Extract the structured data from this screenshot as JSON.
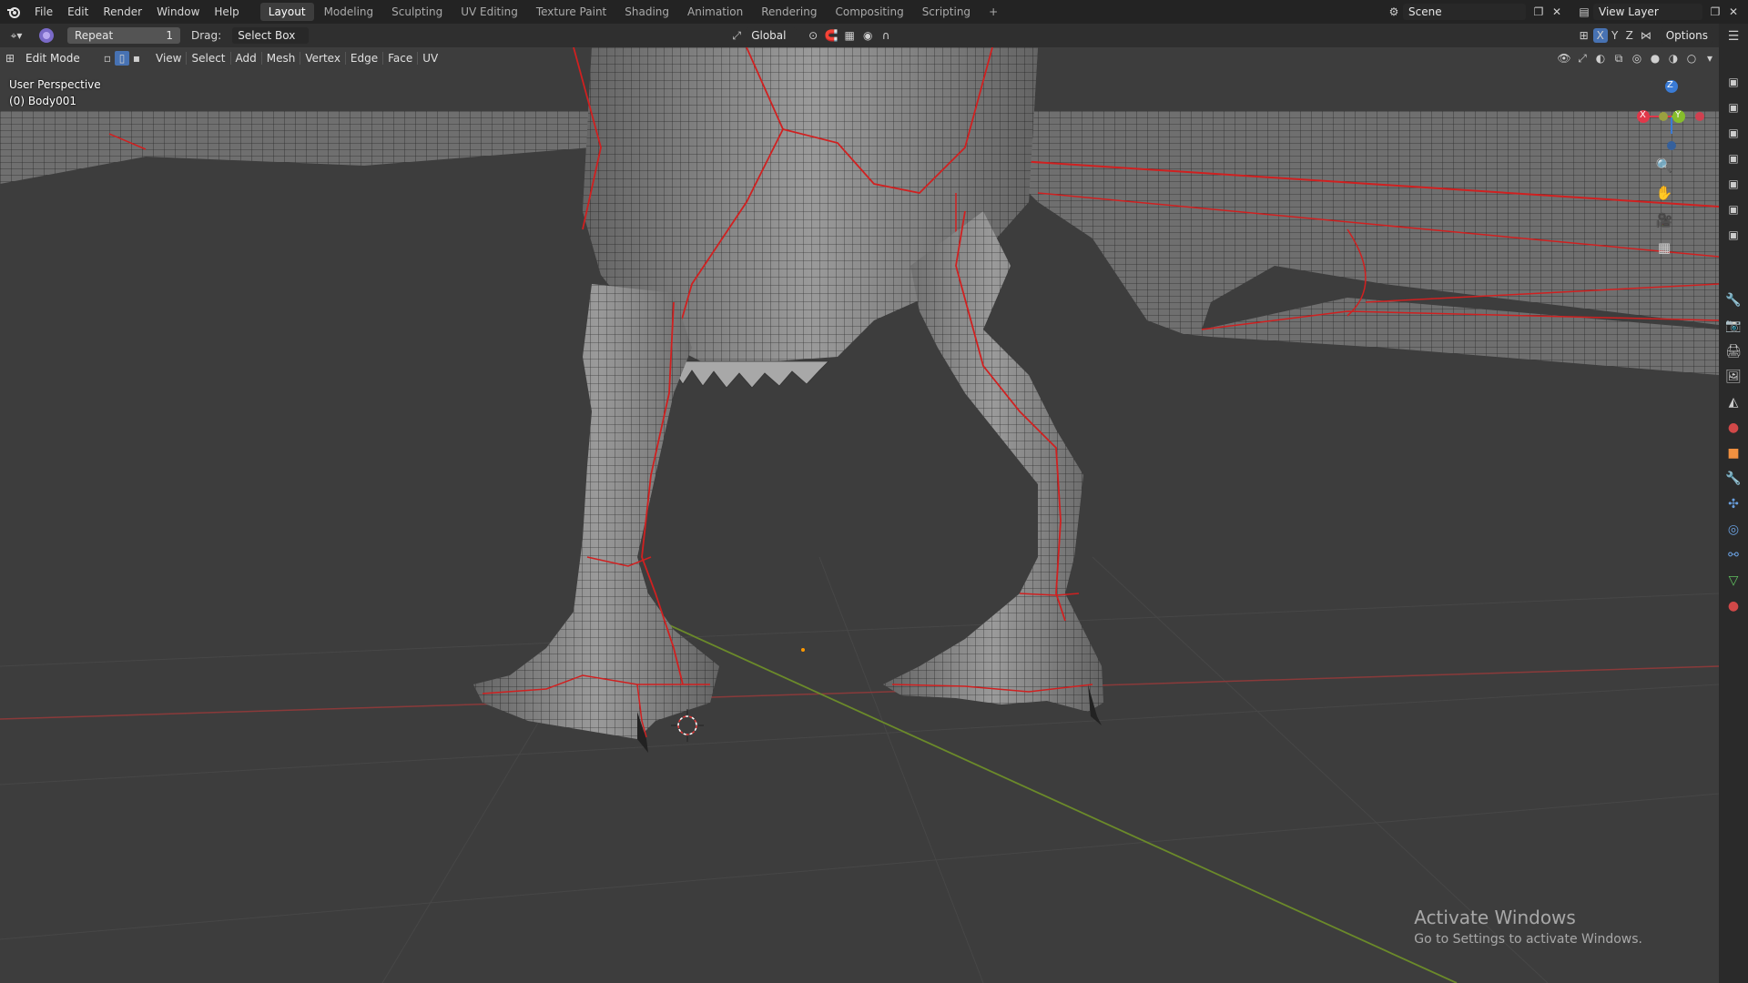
{
  "menubar": {
    "items": [
      "File",
      "Edit",
      "Render",
      "Window",
      "Help"
    ],
    "workspaces": [
      "Layout",
      "Modeling",
      "Sculpting",
      "UV Editing",
      "Texture Paint",
      "Shading",
      "Animation",
      "Rendering",
      "Compositing",
      "Scripting"
    ],
    "active_workspace": "Layout",
    "add_tab": "+",
    "scene": "Scene",
    "view_layer": "View Layer"
  },
  "toolheader": {
    "repeat_label": "Repeat",
    "repeat_value": "1",
    "drag_label": "Drag:",
    "drag_value": "Select Box",
    "transform_orientation": "Global",
    "axis_x": "X",
    "axis_y": "Y",
    "axis_z": "Z",
    "options_label": "Options"
  },
  "viewport_header": {
    "mode": "Edit Mode",
    "menus": [
      "View",
      "Select",
      "Add",
      "Mesh",
      "Vertex",
      "Edge",
      "Face",
      "UV"
    ]
  },
  "viewport": {
    "perspective_label": "User Perspective",
    "object_label": "(0) Body001"
  },
  "gizmo": {
    "x": "X",
    "y": "Y",
    "z": "Z",
    "x_color": "#e0384a",
    "y_color": "#86bd2b",
    "z_color": "#3a7bd5"
  },
  "watermark": {
    "title": "Activate Windows",
    "subtitle": "Go to Settings to activate Windows."
  },
  "colors": {
    "seam": "#e02020",
    "x_axis_line": "#8a3a3a",
    "y_axis_line": "#6b8a2a",
    "mesh": "#8c8c8c"
  }
}
